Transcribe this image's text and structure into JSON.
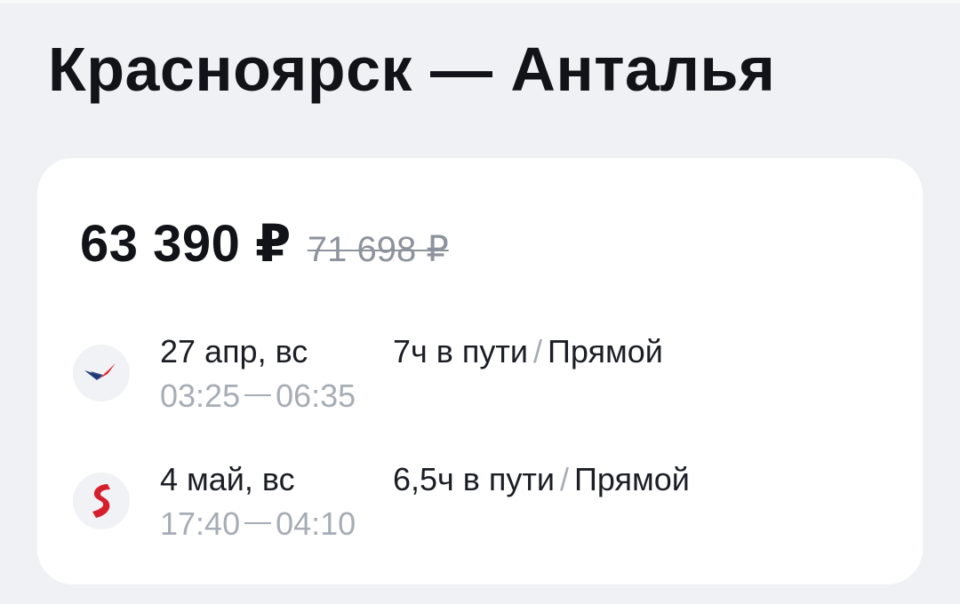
{
  "route": {
    "title": "Красноярск — Анталья"
  },
  "ticket": {
    "price_current": "63 390 ₽",
    "price_old": "71 698 ₽",
    "segments": [
      {
        "airline_icon": "aeroflot-logo-icon",
        "date": "27 апр, вс",
        "departure": "03:25",
        "arrival": "06:35",
        "duration": "7ч в пути",
        "separator": "/",
        "type": "Прямой"
      },
      {
        "airline_icon": "s7-logo-icon",
        "date": "4 май, вс",
        "departure": "17:40",
        "arrival": "04:10",
        "duration": "6,5ч в пути",
        "separator": "/",
        "type": "Прямой"
      }
    ]
  },
  "colors": {
    "background": "#eff1f5",
    "card": "#ffffff",
    "text_primary": "#111318",
    "text_muted": "#a7adb6",
    "aeroflot_blue": "#1f3a78",
    "aeroflot_red": "#e0202a",
    "s7_red": "#d61f2c"
  }
}
